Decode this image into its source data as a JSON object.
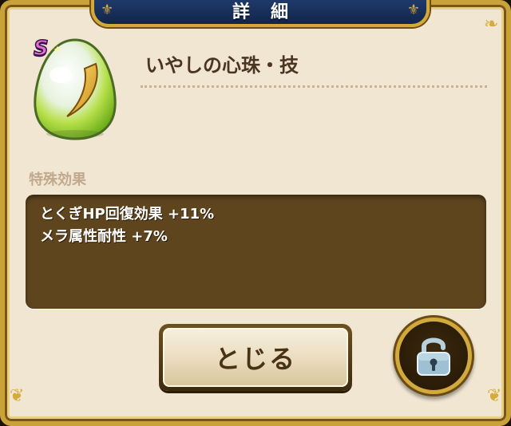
{
  "header": {
    "title": "詳細"
  },
  "item": {
    "rank_badge": "S",
    "name": "いやしの心珠・技",
    "icon": "green-egg-jewel-icon"
  },
  "effects": {
    "section_label": "特殊効果",
    "lines": [
      "とくぎHP回復効果 +11%",
      "メラ属性耐性 +7%"
    ]
  },
  "actions": {
    "close_label": "とじる",
    "lock_icon": "unlocked-padlock-icon"
  },
  "colors": {
    "panel_background": "#f1e6d2",
    "effects_background": "#5e451e",
    "frame_gold": "#caa23a",
    "header_navy": "#1f3a6b"
  }
}
